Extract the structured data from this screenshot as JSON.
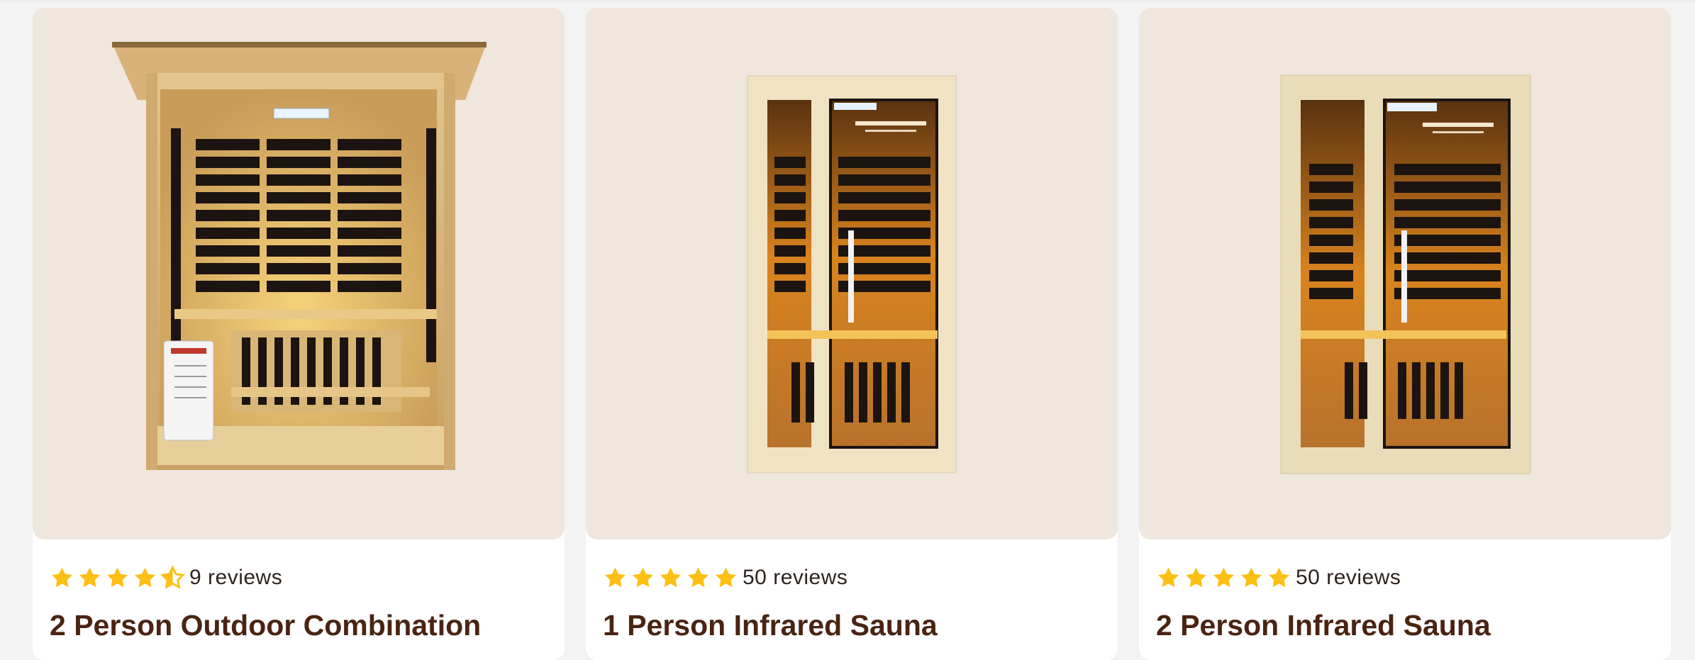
{
  "colors": {
    "page_bg": "#f3f3f3",
    "media_bg": "#efe7de",
    "star": "#fcbf14",
    "title": "#4a2412",
    "review_text": "#2e2420"
  },
  "products": [
    {
      "image_icon": "sauna-outdoor-combination-image",
      "rating": 4.5,
      "stars": [
        "full",
        "full",
        "full",
        "full",
        "half"
      ],
      "reviews_label": "9 reviews",
      "title": "2 Person Outdoor Combination"
    },
    {
      "image_icon": "sauna-1-person-image",
      "rating": 5,
      "stars": [
        "full",
        "full",
        "full",
        "full",
        "full"
      ],
      "reviews_label": "50 reviews",
      "title": "1 Person Infrared Sauna"
    },
    {
      "image_icon": "sauna-2-person-image",
      "rating": 5,
      "stars": [
        "full",
        "full",
        "full",
        "full",
        "full"
      ],
      "reviews_label": "50 reviews",
      "title": "2 Person Infrared Sauna"
    }
  ]
}
